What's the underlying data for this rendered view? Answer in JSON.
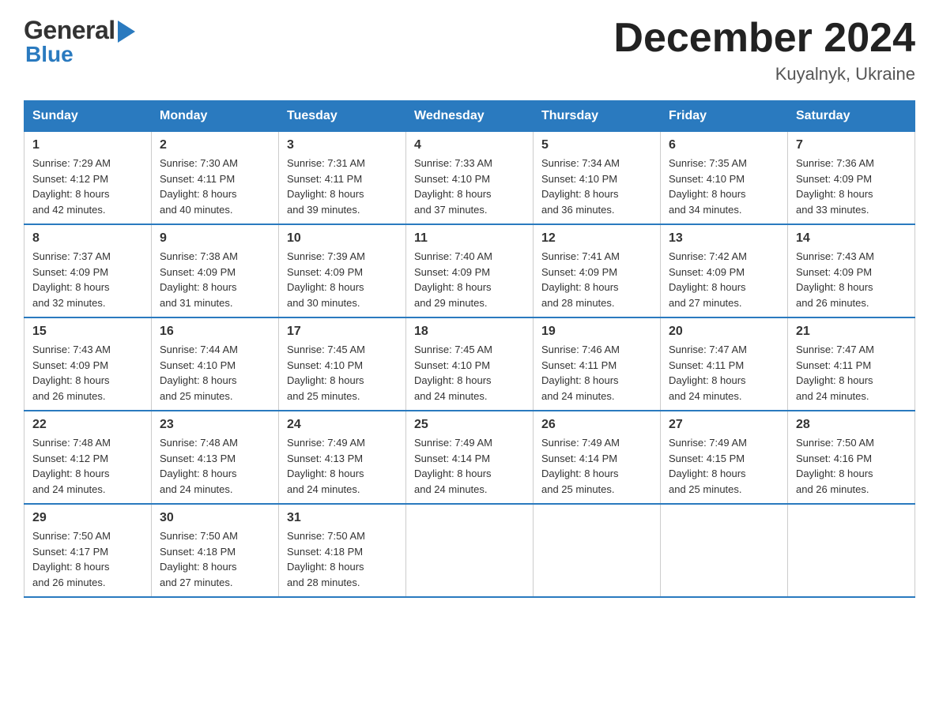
{
  "header": {
    "logo_line1": "General",
    "logo_line2": "Blue",
    "month_year": "December 2024",
    "location": "Kuyalnyk, Ukraine"
  },
  "days_of_week": [
    "Sunday",
    "Monday",
    "Tuesday",
    "Wednesday",
    "Thursday",
    "Friday",
    "Saturday"
  ],
  "weeks": [
    [
      {
        "day": "1",
        "sunrise": "7:29 AM",
        "sunset": "4:12 PM",
        "daylight": "8 hours and 42 minutes."
      },
      {
        "day": "2",
        "sunrise": "7:30 AM",
        "sunset": "4:11 PM",
        "daylight": "8 hours and 40 minutes."
      },
      {
        "day": "3",
        "sunrise": "7:31 AM",
        "sunset": "4:11 PM",
        "daylight": "8 hours and 39 minutes."
      },
      {
        "day": "4",
        "sunrise": "7:33 AM",
        "sunset": "4:10 PM",
        "daylight": "8 hours and 37 minutes."
      },
      {
        "day": "5",
        "sunrise": "7:34 AM",
        "sunset": "4:10 PM",
        "daylight": "8 hours and 36 minutes."
      },
      {
        "day": "6",
        "sunrise": "7:35 AM",
        "sunset": "4:10 PM",
        "daylight": "8 hours and 34 minutes."
      },
      {
        "day": "7",
        "sunrise": "7:36 AM",
        "sunset": "4:09 PM",
        "daylight": "8 hours and 33 minutes."
      }
    ],
    [
      {
        "day": "8",
        "sunrise": "7:37 AM",
        "sunset": "4:09 PM",
        "daylight": "8 hours and 32 minutes."
      },
      {
        "day": "9",
        "sunrise": "7:38 AM",
        "sunset": "4:09 PM",
        "daylight": "8 hours and 31 minutes."
      },
      {
        "day": "10",
        "sunrise": "7:39 AM",
        "sunset": "4:09 PM",
        "daylight": "8 hours and 30 minutes."
      },
      {
        "day": "11",
        "sunrise": "7:40 AM",
        "sunset": "4:09 PM",
        "daylight": "8 hours and 29 minutes."
      },
      {
        "day": "12",
        "sunrise": "7:41 AM",
        "sunset": "4:09 PM",
        "daylight": "8 hours and 28 minutes."
      },
      {
        "day": "13",
        "sunrise": "7:42 AM",
        "sunset": "4:09 PM",
        "daylight": "8 hours and 27 minutes."
      },
      {
        "day": "14",
        "sunrise": "7:43 AM",
        "sunset": "4:09 PM",
        "daylight": "8 hours and 26 minutes."
      }
    ],
    [
      {
        "day": "15",
        "sunrise": "7:43 AM",
        "sunset": "4:09 PM",
        "daylight": "8 hours and 26 minutes."
      },
      {
        "day": "16",
        "sunrise": "7:44 AM",
        "sunset": "4:10 PM",
        "daylight": "8 hours and 25 minutes."
      },
      {
        "day": "17",
        "sunrise": "7:45 AM",
        "sunset": "4:10 PM",
        "daylight": "8 hours and 25 minutes."
      },
      {
        "day": "18",
        "sunrise": "7:45 AM",
        "sunset": "4:10 PM",
        "daylight": "8 hours and 24 minutes."
      },
      {
        "day": "19",
        "sunrise": "7:46 AM",
        "sunset": "4:11 PM",
        "daylight": "8 hours and 24 minutes."
      },
      {
        "day": "20",
        "sunrise": "7:47 AM",
        "sunset": "4:11 PM",
        "daylight": "8 hours and 24 minutes."
      },
      {
        "day": "21",
        "sunrise": "7:47 AM",
        "sunset": "4:11 PM",
        "daylight": "8 hours and 24 minutes."
      }
    ],
    [
      {
        "day": "22",
        "sunrise": "7:48 AM",
        "sunset": "4:12 PM",
        "daylight": "8 hours and 24 minutes."
      },
      {
        "day": "23",
        "sunrise": "7:48 AM",
        "sunset": "4:13 PM",
        "daylight": "8 hours and 24 minutes."
      },
      {
        "day": "24",
        "sunrise": "7:49 AM",
        "sunset": "4:13 PM",
        "daylight": "8 hours and 24 minutes."
      },
      {
        "day": "25",
        "sunrise": "7:49 AM",
        "sunset": "4:14 PM",
        "daylight": "8 hours and 24 minutes."
      },
      {
        "day": "26",
        "sunrise": "7:49 AM",
        "sunset": "4:14 PM",
        "daylight": "8 hours and 25 minutes."
      },
      {
        "day": "27",
        "sunrise": "7:49 AM",
        "sunset": "4:15 PM",
        "daylight": "8 hours and 25 minutes."
      },
      {
        "day": "28",
        "sunrise": "7:50 AM",
        "sunset": "4:16 PM",
        "daylight": "8 hours and 26 minutes."
      }
    ],
    [
      {
        "day": "29",
        "sunrise": "7:50 AM",
        "sunset": "4:17 PM",
        "daylight": "8 hours and 26 minutes."
      },
      {
        "day": "30",
        "sunrise": "7:50 AM",
        "sunset": "4:18 PM",
        "daylight": "8 hours and 27 minutes."
      },
      {
        "day": "31",
        "sunrise": "7:50 AM",
        "sunset": "4:18 PM",
        "daylight": "8 hours and 28 minutes."
      },
      null,
      null,
      null,
      null
    ]
  ],
  "cell_labels": {
    "sunrise": "Sunrise: ",
    "sunset": "Sunset: ",
    "daylight": "Daylight: "
  }
}
